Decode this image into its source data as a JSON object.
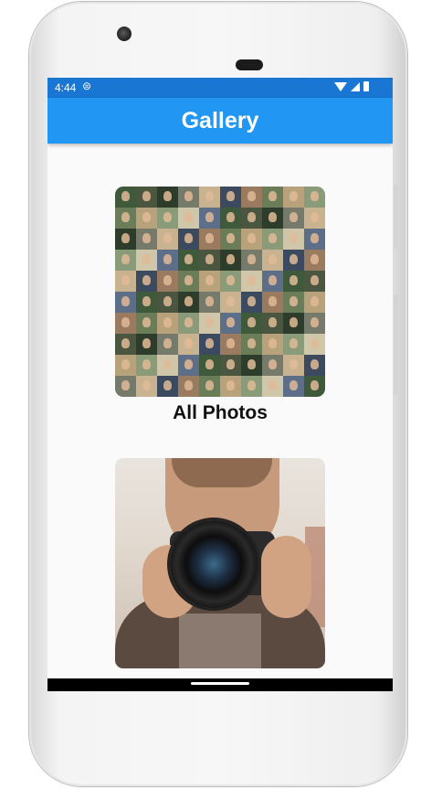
{
  "status_bar": {
    "time": "4:44",
    "notification_icon": "sim-icon",
    "indicators": [
      "wifi-icon",
      "signal-icon",
      "battery-icon"
    ]
  },
  "app_bar": {
    "title": "Gallery",
    "background": "#2196f3"
  },
  "albums": [
    {
      "label": "All Photos",
      "thumbnail": "portrait-mosaic"
    },
    {
      "label": "",
      "thumbnail": "photographer-with-camera"
    }
  ]
}
